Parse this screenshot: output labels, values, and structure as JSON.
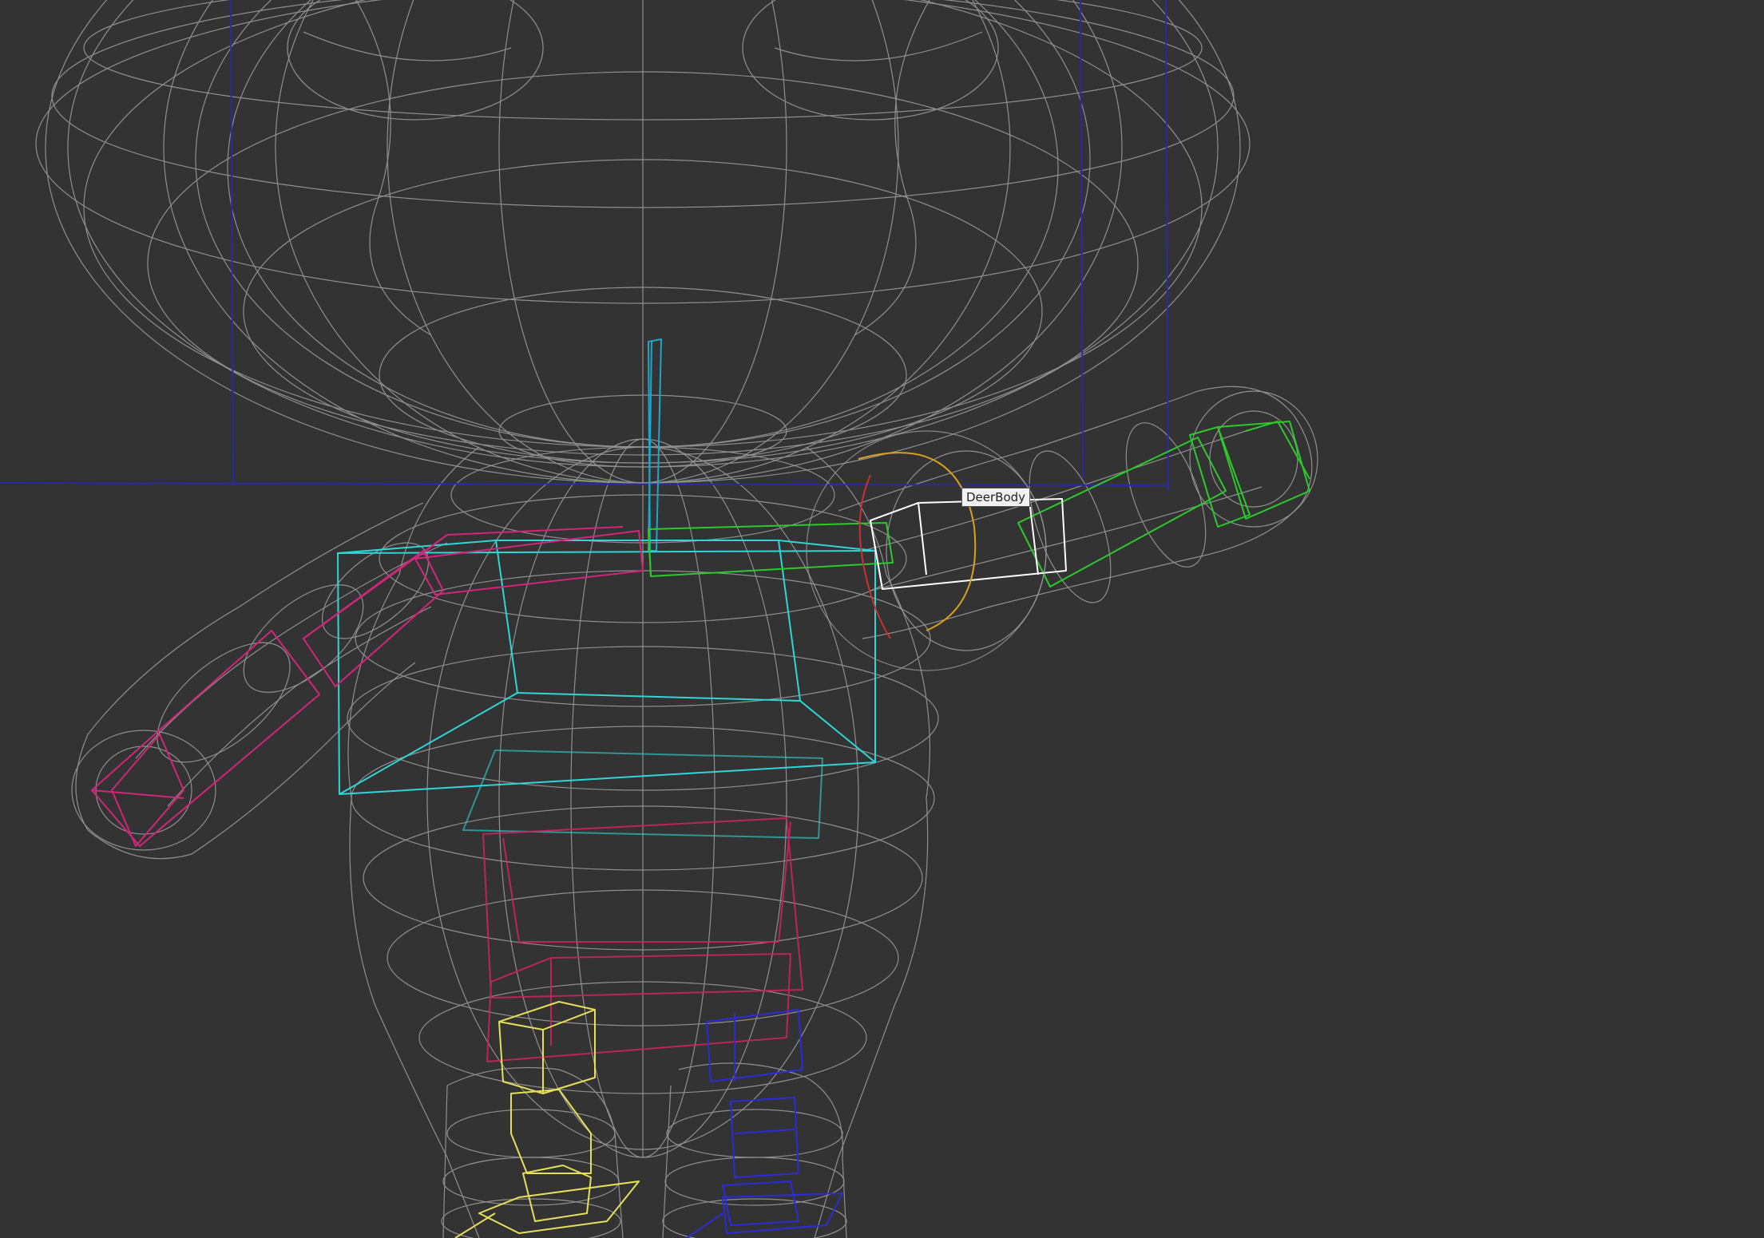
{
  "viewport": {
    "background": "#333333",
    "mode": "wireframe"
  },
  "tooltip": {
    "label": "DeerBody"
  },
  "colors": {
    "mesh": "#9a9a9a",
    "frame": "#2a2aa8",
    "spine": "#1fa6c9",
    "torso": "#2ed6d6",
    "left_arm": "#d1267a",
    "right_arm": "#2cc92c",
    "pelvis": "#c8245e",
    "left_leg": "#e5e05a",
    "right_leg": "#2c2cd6",
    "selection": "#ffffff",
    "gizmo_ring": "#d9a020"
  }
}
